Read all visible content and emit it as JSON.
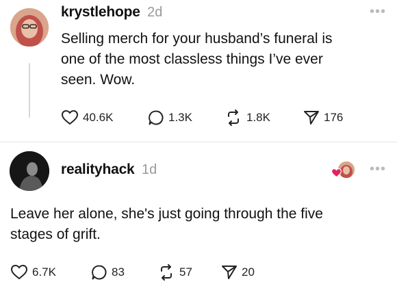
{
  "post1": {
    "username": "krystlehope",
    "time": "2d",
    "text_lines": [
      "Selling merch for your husband’s funeral is",
      "one of the most classless things I’ve ever",
      "seen. Wow."
    ],
    "likes": "40.6K",
    "replies": "1.3K",
    "reposts": "1.8K",
    "shares": "176",
    "more_icon": "more-horizontal-icon"
  },
  "post2": {
    "username": "realityhack",
    "time": "1d",
    "text_lines": [
      "Leave her alone, she's just going through the five",
      "stages of grift."
    ],
    "likes": "6.7K",
    "replies": "83",
    "reposts": "57",
    "shares": "20",
    "more_icon": "more-horizontal-icon"
  },
  "colors": {
    "liked_heart": "#e0245e",
    "muted": "#999999"
  }
}
